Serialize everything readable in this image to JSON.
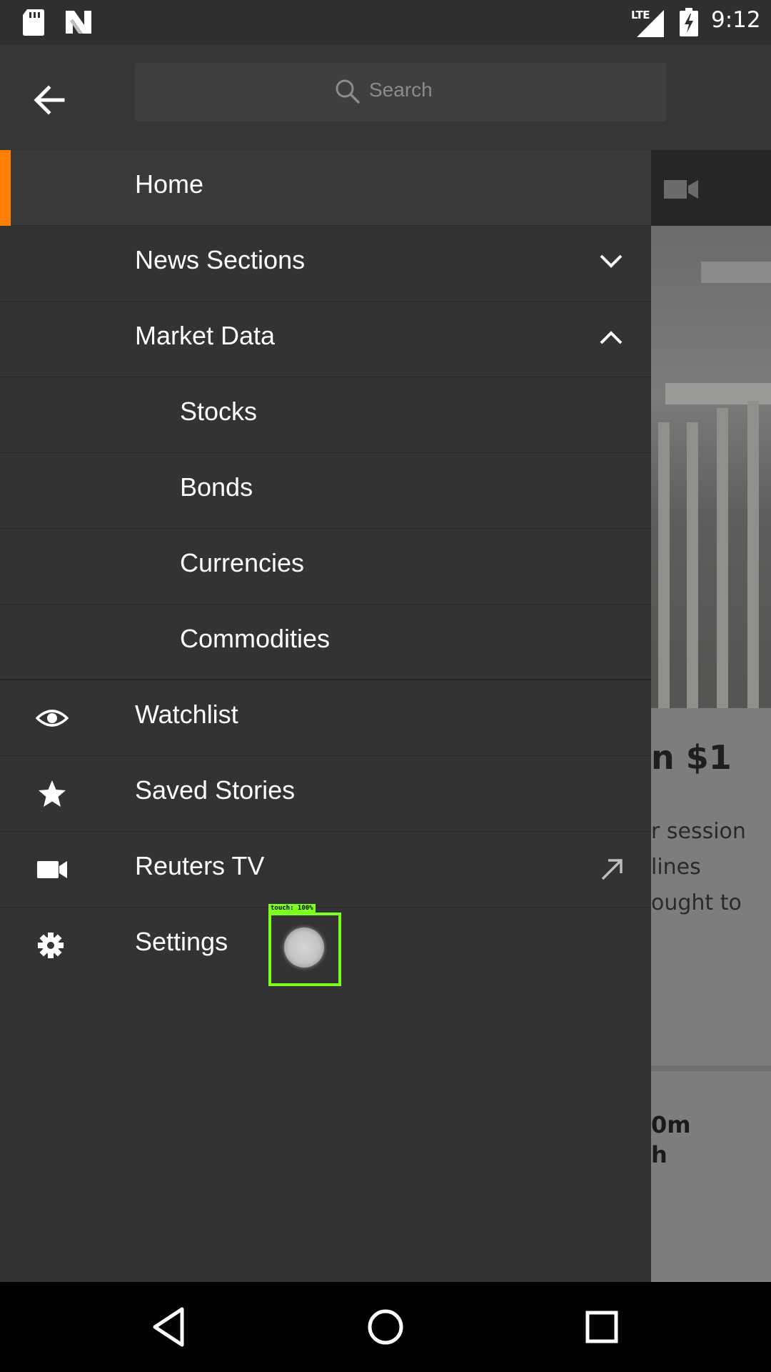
{
  "status_bar": {
    "network": "LTE",
    "time": "9:12",
    "icons": [
      "sd-card-icon",
      "n-logo-icon",
      "signal-icon",
      "battery-charging-icon"
    ]
  },
  "search": {
    "placeholder": "Search"
  },
  "drawer": {
    "items": [
      {
        "label": "Home",
        "active": true
      },
      {
        "label": "News Sections",
        "expand": "collapsed"
      },
      {
        "label": "Market Data",
        "expand": "expanded"
      },
      {
        "label": "Stocks",
        "sub": true
      },
      {
        "label": "Bonds",
        "sub": true
      },
      {
        "label": "Currencies",
        "sub": true
      },
      {
        "label": "Commodities",
        "sub": true
      },
      {
        "label": "Watchlist",
        "icon": "eye-icon"
      },
      {
        "label": "Saved Stories",
        "icon": "star-icon"
      },
      {
        "label": "Reuters TV",
        "icon": "video-camera-icon",
        "external": true
      },
      {
        "label": "Settings",
        "icon": "gear-icon"
      }
    ]
  },
  "background_article": {
    "headline_fragment": "n $1",
    "text_lines": [
      "r session",
      "lines",
      "ought to"
    ],
    "second_headline": [
      "0m",
      "h"
    ]
  },
  "touch_overlay": {
    "label": "touch: 100%"
  },
  "colors": {
    "accent": "#ff8000",
    "drawer_bg": "#333333",
    "touch_box": "#7cff1a"
  }
}
